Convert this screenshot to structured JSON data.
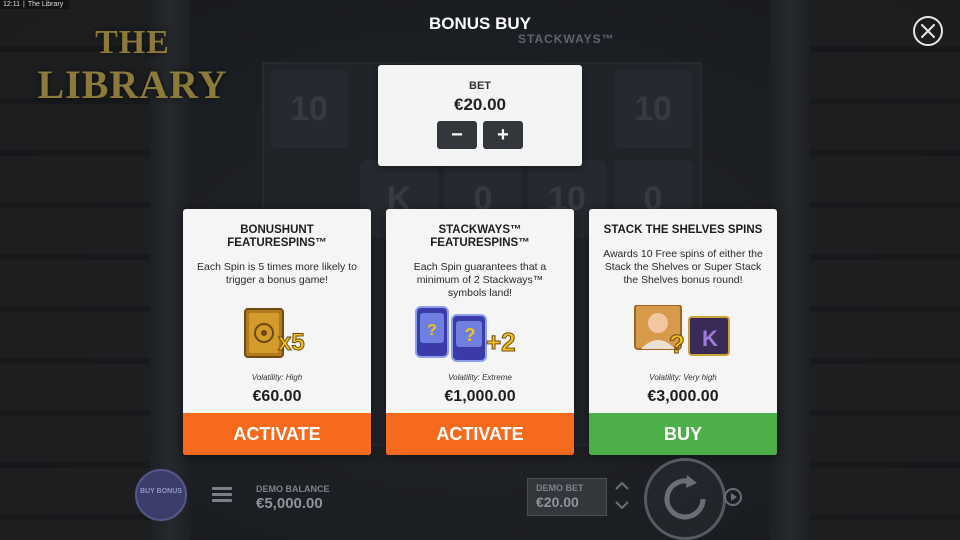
{
  "statusbar": {
    "time": "12:11",
    "title": "The Library"
  },
  "logo": {
    "line1": "THE",
    "line2": "LIBRARY"
  },
  "background": {
    "stackways_tag": "STACKWAYS™",
    "reel_symbols": [
      "10",
      "K",
      "0",
      "10",
      "0",
      "10"
    ]
  },
  "header": {
    "title": "BONUS BUY"
  },
  "bet": {
    "label": "BET",
    "value": "€20.00",
    "minus_label": "−",
    "plus_label": "+"
  },
  "cards": [
    {
      "title": "BONUSHUNT FEATURESPINS™",
      "description": "Each Spin is 5 times more likely to trigger a bonus game!",
      "art_text": "x5",
      "volatility": "Volatility: High",
      "price": "€60.00",
      "button": "ACTIVATE"
    },
    {
      "title": "STACKWAYS™ FEATURESPINS™",
      "description": "Each Spin guarantees that a minimum of 2 Stackways™ symbols land!",
      "art_text": "+2",
      "volatility": "Volatility: Extreme",
      "price": "€1,000.00",
      "button": "ACTIVATE"
    },
    {
      "title": "STACK THE SHELVES SPINS",
      "description": "Awards 10 Free spins of either the Stack the Shelves or Super Stack the Shelves bonus round!",
      "art_text": "K",
      "volatility": "Volatility: Very high",
      "price": "€3,000.00",
      "button": "BUY"
    }
  ],
  "footer": {
    "buy_bonus_label": "BUY BONUS",
    "demo_balance_label": "DEMO BALANCE",
    "demo_balance_value": "€5,000.00",
    "demo_bet_label": "DEMO BET",
    "demo_bet_value": "€20.00"
  },
  "colors": {
    "activate": "#f56a1c",
    "buy": "#4caf4a",
    "panel": "#f5f5f5"
  }
}
